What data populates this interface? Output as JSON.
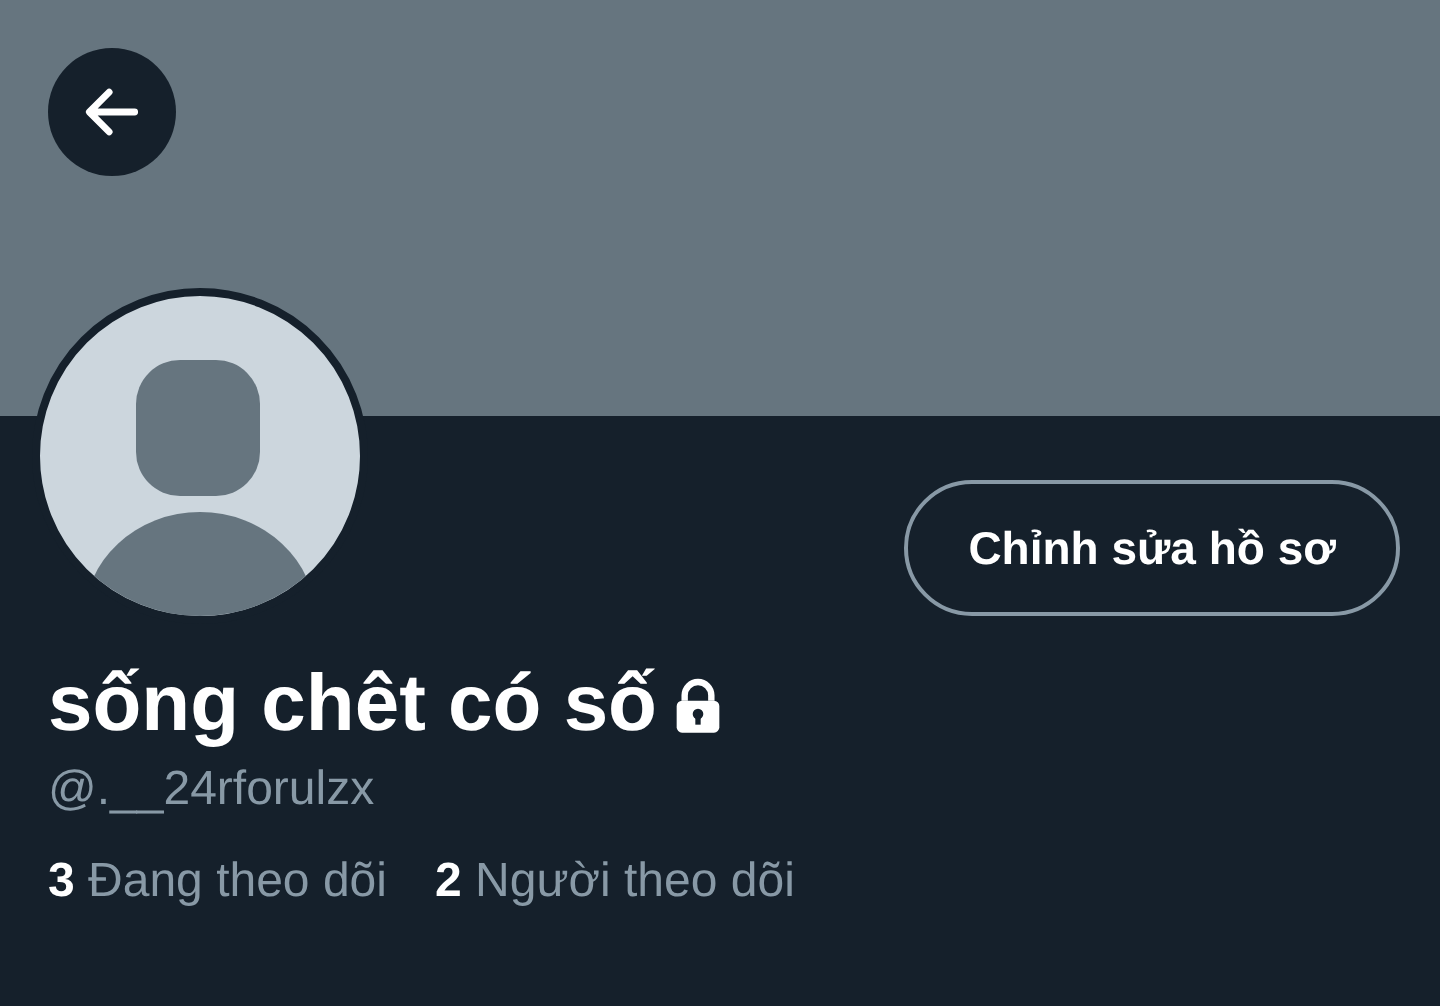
{
  "profile": {
    "name": "sống chêt có số",
    "locked": true,
    "handle": "@.__24rforulzx",
    "edit_button": "Chỉnh sửa hồ sơ"
  },
  "stats": [
    {
      "count": "3",
      "label": "Đang theo dõi"
    },
    {
      "count": "2",
      "label": "Người theo dõi"
    }
  ]
}
